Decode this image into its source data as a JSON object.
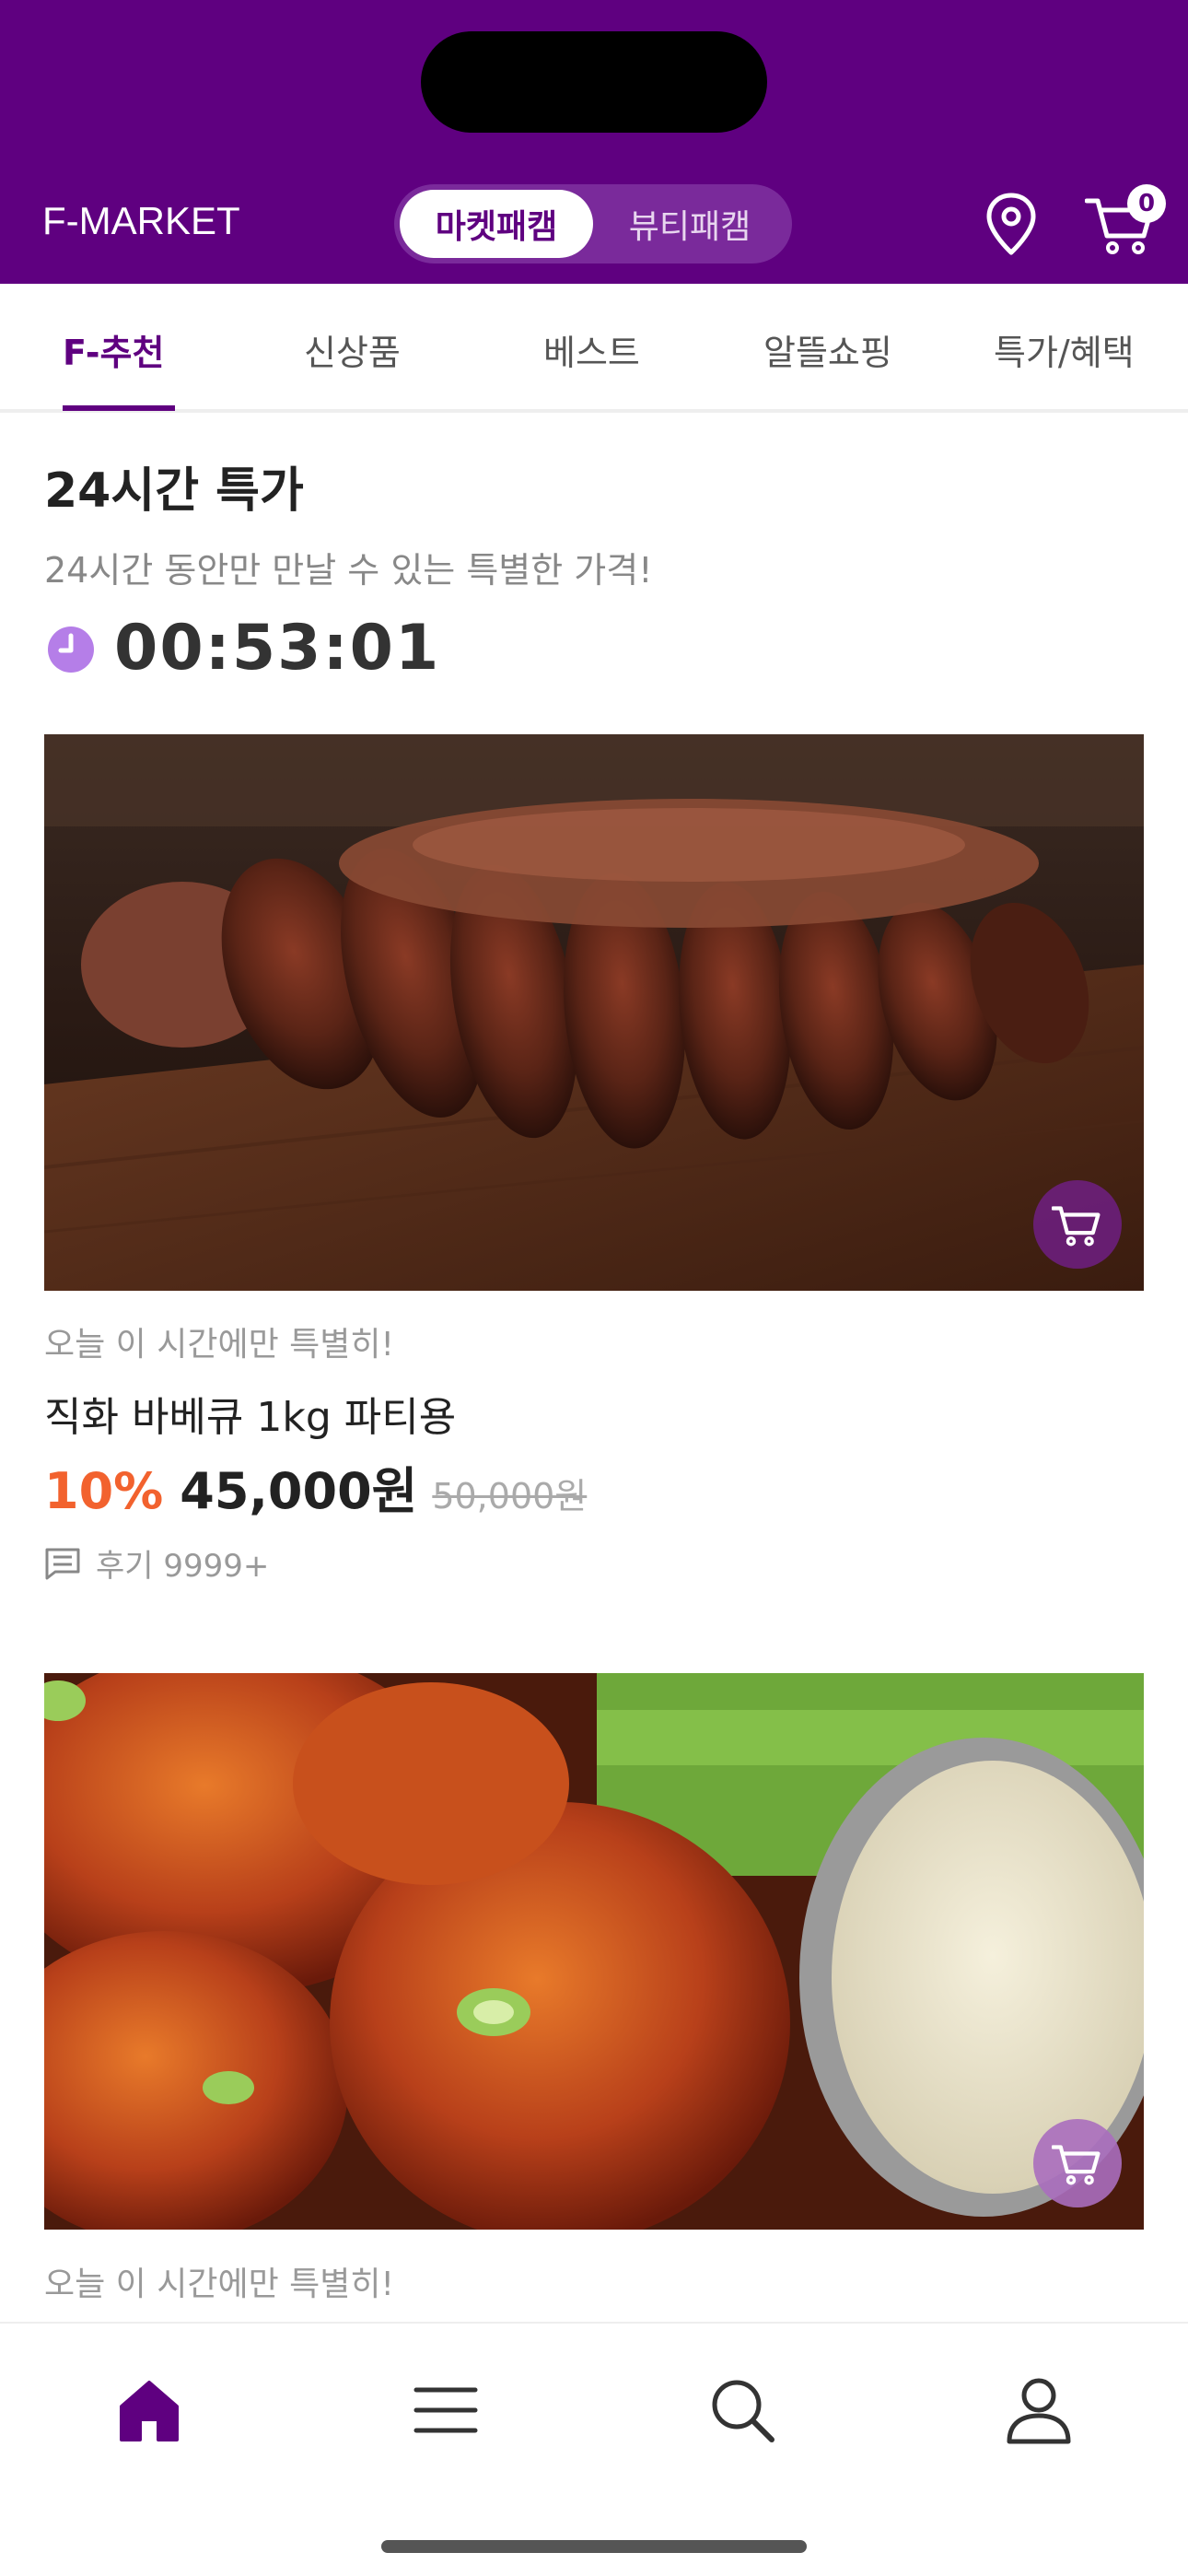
{
  "header": {
    "logo": "F-MARKET",
    "segments": [
      "마켓패캠",
      "뷰티패캠"
    ],
    "cart_count": "0",
    "background": "#5f0080"
  },
  "tabs": [
    "F-추천",
    "신상품",
    "베스트",
    "알뜰쇼핑",
    "특가/혜택"
  ],
  "section": {
    "title": "24시간 특가",
    "subtitle": "24시간 동안만 만날 수 있는 특별한 가격!",
    "timer": "00:53:01"
  },
  "products": [
    {
      "image": "sliced grilled steak on wooden board",
      "note": "오늘 이 시간에만 특별히!",
      "name": "직화 바베큐 1kg 파티용",
      "discount": "10%",
      "price": "45,000원",
      "original_price": "50,000원",
      "review": "후기 9999+"
    },
    {
      "image": "glazed chicken wings with dipping sauce",
      "note": "오늘 이 시간에만 특별히!"
    }
  ],
  "bottom_nav": [
    "home-icon",
    "menu-icon",
    "search-icon",
    "user-icon"
  ],
  "colors": {
    "primary": "#5f0080",
    "discount": "#f2622e"
  }
}
